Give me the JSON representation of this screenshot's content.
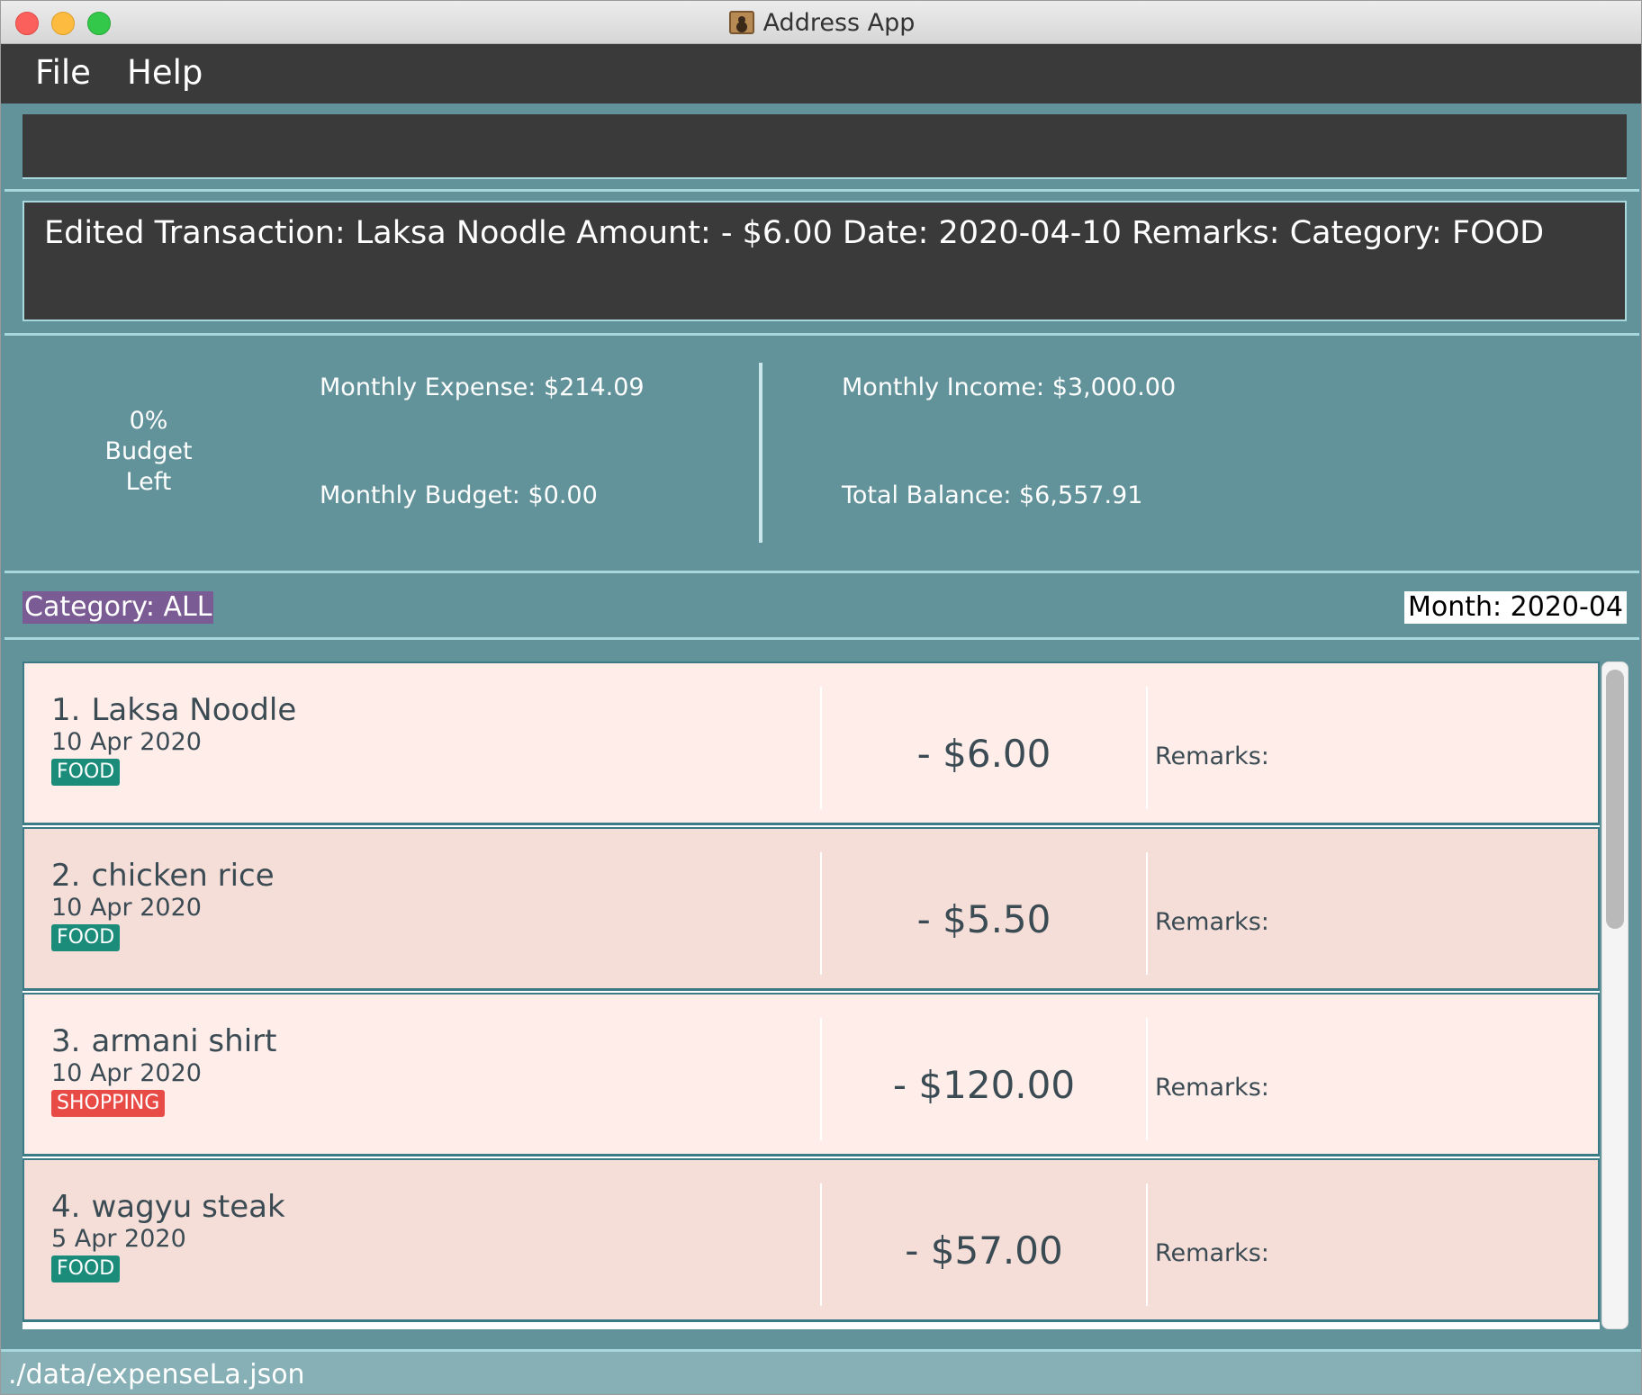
{
  "window": {
    "title": "Address App"
  },
  "menu": {
    "file": "File",
    "help": "Help"
  },
  "command": {
    "value": "",
    "placeholder": ""
  },
  "result": {
    "message": "Edited Transaction: Laksa Noodle Amount: - $6.00 Date: 2020-04-10 Remarks:  Category: FOOD"
  },
  "summary": {
    "budget_percent": "0%",
    "budget_word": "Budget",
    "left_word": "Left",
    "monthly_expense": "Monthly Expense: $214.09",
    "monthly_budget": "Monthly Budget: $0.00",
    "monthly_income": "Monthly Income: $3,000.00",
    "total_balance": "Total Balance: $6,557.91"
  },
  "filter": {
    "category": "Category: ALL",
    "month": "Month: 2020-04"
  },
  "transactions": [
    {
      "index": "1.",
      "name": "Laksa Noodle",
      "date": "10 Apr 2020",
      "category": "FOOD",
      "amount": "- $6.00",
      "remarks": "Remarks:"
    },
    {
      "index": "2.",
      "name": "chicken rice",
      "date": "10 Apr 2020",
      "category": "FOOD",
      "amount": "- $5.50",
      "remarks": "Remarks:"
    },
    {
      "index": "3.",
      "name": "armani shirt",
      "date": "10 Apr 2020",
      "category": "SHOPPING",
      "amount": "- $120.00",
      "remarks": "Remarks:"
    },
    {
      "index": "4.",
      "name": "wagyu steak",
      "date": "5 Apr 2020",
      "category": "FOOD",
      "amount": "- $57.00",
      "remarks": "Remarks:"
    }
  ],
  "status": {
    "path": "./data/expenseLa.json"
  },
  "colors": {
    "panel": "#62939a",
    "dark": "#3a3a3a",
    "food_tag": "#1b8c7a",
    "shopping_tag": "#e84a46",
    "category_badge": "#7a5b93"
  }
}
